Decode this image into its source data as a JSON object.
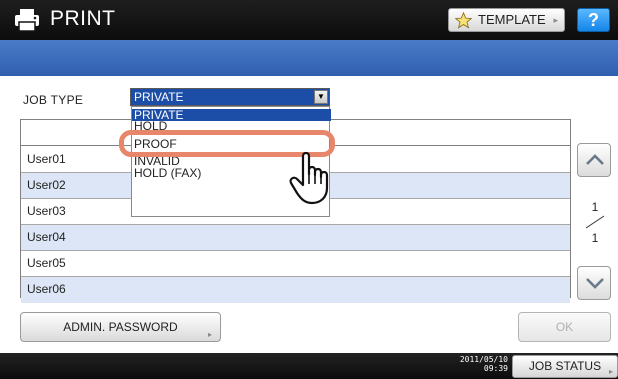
{
  "header": {
    "title": "PRINT",
    "template_label": "TEMPLATE",
    "help_label": "?"
  },
  "job_type": {
    "label": "JOB TYPE",
    "selected": "PRIVATE",
    "options": [
      "PRIVATE",
      "HOLD",
      "PROOF",
      "INVALID",
      "HOLD (FAX)"
    ],
    "highlighted_option": "PROOF"
  },
  "table": {
    "rows": [
      "User01",
      "User02",
      "User03",
      "User04",
      "User05",
      "User06"
    ]
  },
  "pagination": {
    "current": "1",
    "total": "1"
  },
  "buttons": {
    "admin_password": "ADMIN. PASSWORD",
    "ok": "OK",
    "job_status": "JOB STATUS"
  },
  "footer": {
    "date": "2011/05/10",
    "time": "09:39"
  },
  "icons": {
    "printer": "printer-icon",
    "template": "star-icon",
    "scroll_up": "chevron-up-icon",
    "scroll_down": "chevron-down-icon",
    "cursor": "hand-pointer-icon"
  },
  "colors": {
    "title_bar": "#141414",
    "band": "#3a6bbd",
    "selection": "#1c4ea8",
    "row_alt": "#dce6f6",
    "highlight": "#e8866b",
    "help_button": "#1f8ef0"
  }
}
